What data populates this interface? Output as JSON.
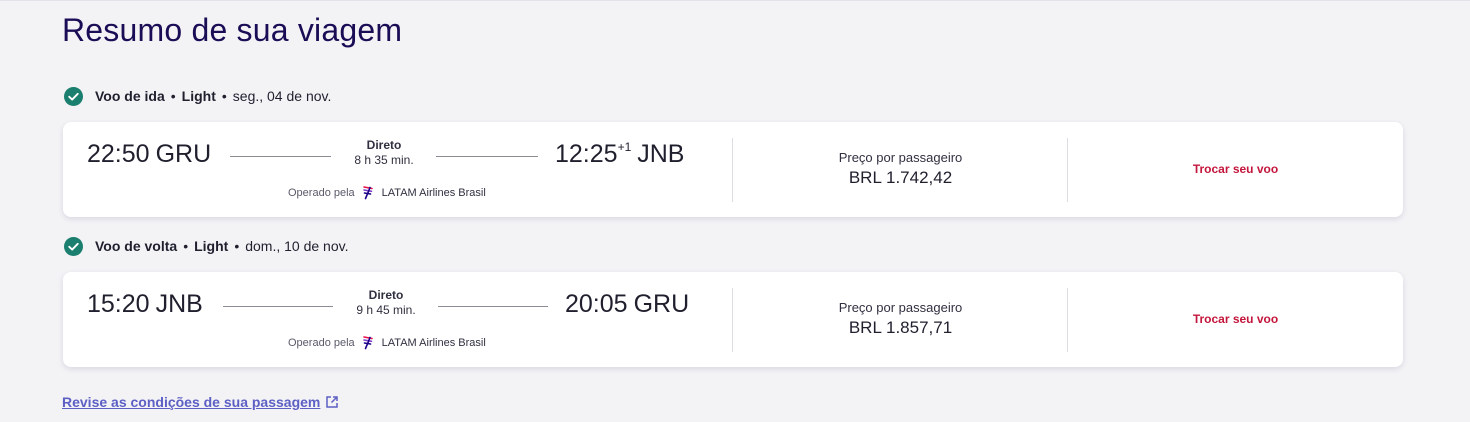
{
  "page": {
    "title": "Resumo de sua viagem",
    "conditions_link": "Revise as condições de sua passagem"
  },
  "colors": {
    "title": "#1a0c55",
    "check": "#1a7f6e",
    "change_link": "#c4163c",
    "conditions_link": "#5c5fc4",
    "background": "#f3f3f6"
  },
  "icons": {
    "check": "check-circle-icon",
    "airline_logo": "latam-logo-icon",
    "external": "external-link-icon"
  },
  "outbound": {
    "header": {
      "label": "Voo de ida",
      "fare": "Light",
      "date": "seg., 04 de nov."
    },
    "departure_time": "22:50",
    "departure_code": "GRU",
    "stops": "Direto",
    "duration": "8 h 35 min.",
    "arrival_time": "12:25",
    "arrival_offset": "+1",
    "arrival_code": "JNB",
    "operated_label": "Operado pela",
    "airline": "LATAM Airlines Brasil",
    "price_label": "Preço por passageiro",
    "price": "BRL 1.742,42",
    "change_label": "Trocar seu voo"
  },
  "inbound": {
    "header": {
      "label": "Voo de volta",
      "fare": "Light",
      "date": "dom., 10 de nov."
    },
    "departure_time": "15:20",
    "departure_code": "JNB",
    "stops": "Direto",
    "duration": "9 h 45 min.",
    "arrival_time": "20:05",
    "arrival_code": "GRU",
    "operated_label": "Operado pela",
    "airline": "LATAM Airlines Brasil",
    "price_label": "Preço por passageiro",
    "price": "BRL 1.857,71",
    "change_label": "Trocar seu voo"
  }
}
